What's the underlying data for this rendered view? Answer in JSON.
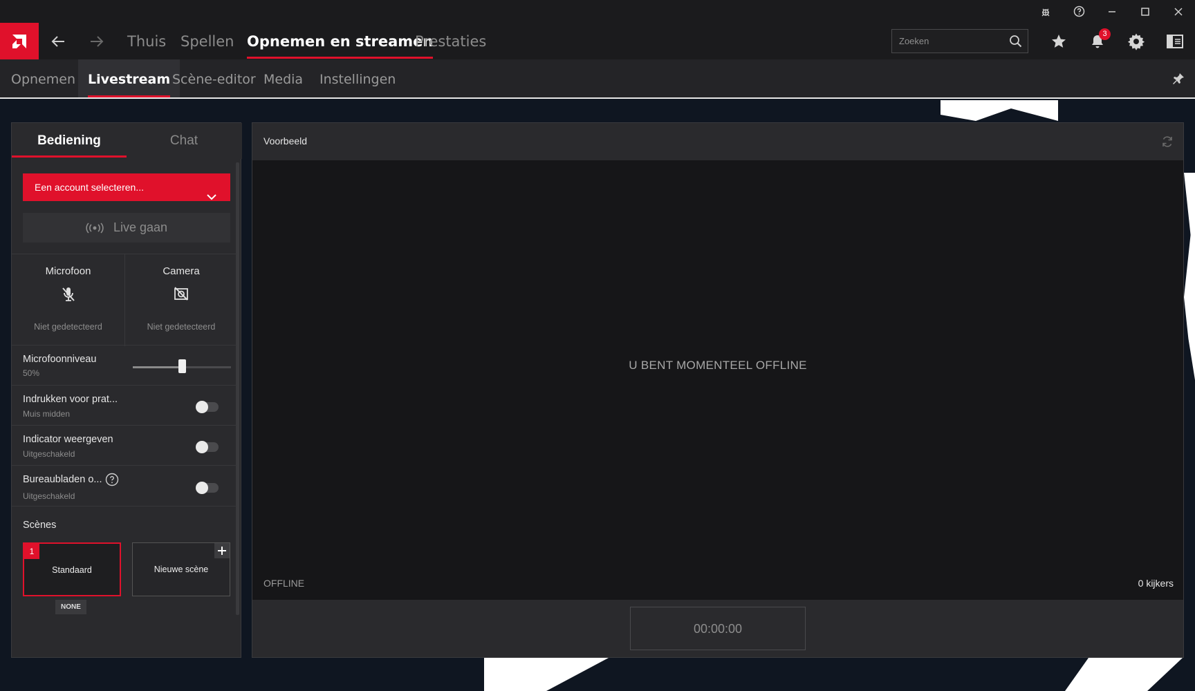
{
  "window": {
    "buttons": [
      "bug-icon",
      "help-icon",
      "minimize-icon",
      "maximize-icon",
      "close-icon"
    ]
  },
  "mainnav": {
    "tabs": [
      {
        "label": "Thuis",
        "active": false
      },
      {
        "label": "Spellen",
        "active": false
      },
      {
        "label": "Opnemen en streamen",
        "active": true
      },
      {
        "label": "Prestaties",
        "active": false
      }
    ],
    "search_placeholder": "Zoeken",
    "notifications_count": "3"
  },
  "subnav": {
    "tabs": [
      {
        "label": "Opnemen",
        "active": false
      },
      {
        "label": "Livestream",
        "active": true
      },
      {
        "label": "Scène-editor",
        "active": false
      },
      {
        "label": "Media",
        "active": false
      },
      {
        "label": "Instellingen",
        "active": false
      }
    ]
  },
  "panel": {
    "tabs": [
      {
        "label": "Bediening",
        "active": true
      },
      {
        "label": "Chat",
        "active": false
      }
    ],
    "account_select": "Een account selecteren...",
    "go_live": "Live gaan",
    "devices": [
      {
        "title": "Microfoon",
        "status": "Niet gedetecteerd",
        "icon": "mic-off-icon"
      },
      {
        "title": "Camera",
        "status": "Niet gedetecteerd",
        "icon": "camera-off-icon"
      }
    ],
    "mic_level": {
      "label": "Microfoonniveau",
      "value": "50%",
      "fraction": 0.5
    },
    "settings": [
      {
        "title": "Indrukken voor prat...",
        "subtitle": "Muis midden",
        "on": false
      },
      {
        "title": "Indicator weergeven",
        "subtitle": "Uitgeschakeld",
        "on": false
      },
      {
        "title": "Bureaubladen o...",
        "subtitle": "Uitgeschakeld",
        "on": false,
        "help": true
      }
    ],
    "scenes_title": "Scènes",
    "scenes": [
      {
        "number": "1",
        "label": "Standaard",
        "active": true,
        "hotkey": "NONE"
      },
      {
        "label": "Nieuwe scène",
        "active": false
      }
    ]
  },
  "preview": {
    "title": "Voorbeeld",
    "message": "U BENT MOMENTEEL OFFLINE",
    "status": "OFFLINE",
    "viewers": "0 kijkers",
    "timer": "00:00:00"
  },
  "colors": {
    "accent": "#e0112b",
    "panel": "#2a2a2d",
    "background": "#0f1621"
  }
}
